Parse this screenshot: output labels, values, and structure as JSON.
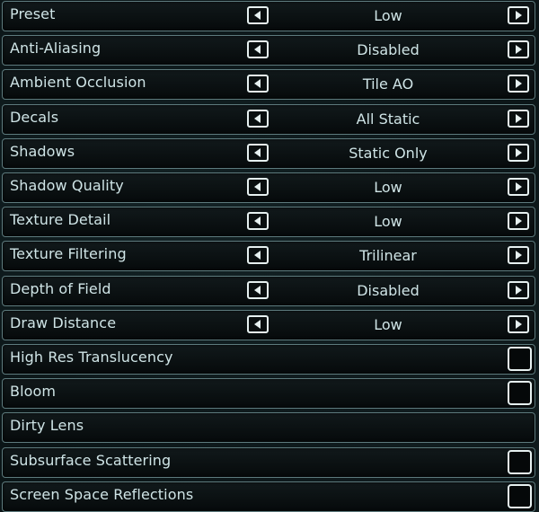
{
  "settings": [
    {
      "label": "Preset",
      "type": "select",
      "value": "Low"
    },
    {
      "label": "Anti-Aliasing",
      "type": "select",
      "value": "Disabled"
    },
    {
      "label": "Ambient Occlusion",
      "type": "select",
      "value": "Tile AO"
    },
    {
      "label": "Decals",
      "type": "select",
      "value": "All Static"
    },
    {
      "label": "Shadows",
      "type": "select",
      "value": "Static Only"
    },
    {
      "label": "Shadow Quality",
      "type": "select",
      "value": "Low"
    },
    {
      "label": "Texture Detail",
      "type": "select",
      "value": "Low"
    },
    {
      "label": "Texture Filtering",
      "type": "select",
      "value": "Trilinear"
    },
    {
      "label": "Depth of Field",
      "type": "select",
      "value": "Disabled"
    },
    {
      "label": "Draw Distance",
      "type": "select",
      "value": "Low"
    },
    {
      "label": "High Res Translucency",
      "type": "checkbox",
      "checked": false
    },
    {
      "label": "Bloom",
      "type": "checkbox",
      "checked": false
    },
    {
      "label": "Dirty Lens",
      "type": "none"
    },
    {
      "label": "Subsurface Scattering",
      "type": "checkbox",
      "checked": false
    },
    {
      "label": "Screen Space Reflections",
      "type": "checkbox",
      "checked": false
    }
  ],
  "icons": {
    "left": "triangle-left-icon",
    "right": "triangle-right-icon"
  },
  "colors": {
    "text": "#cfe4e6",
    "border": "#5d7a7d",
    "button": "#e6f0f0"
  }
}
